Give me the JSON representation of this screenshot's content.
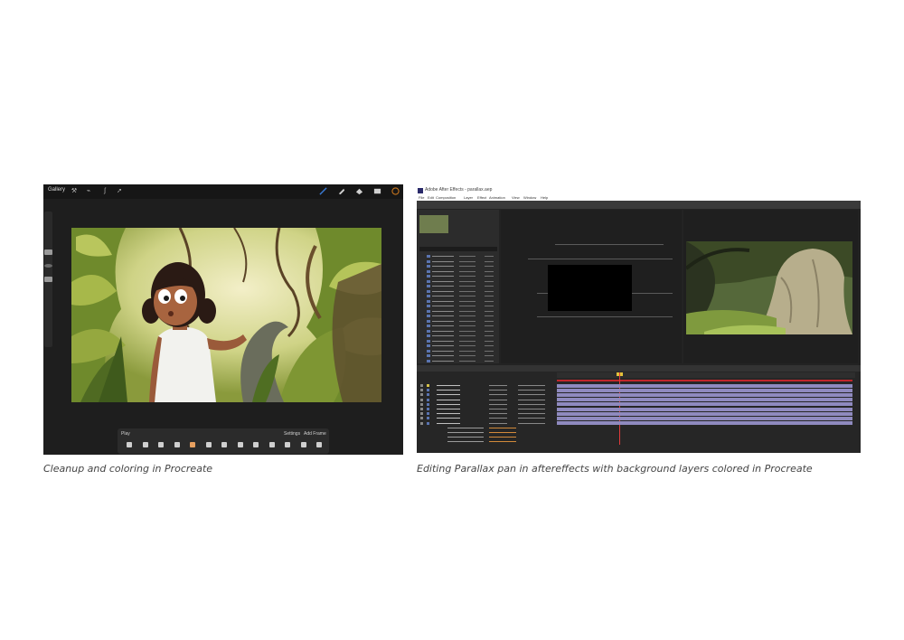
{
  "procreate": {
    "gallery_label": "Gallery",
    "playbar": {
      "play_label": "Play",
      "settings_label": "Settings",
      "add_frame_label": "Add Frame",
      "frame_count": 13,
      "active_frame": 4
    },
    "colors": {
      "brush_blue": "#3a7bd5",
      "color_swatch": "#c8761e"
    }
  },
  "aftereffects": {
    "title": "Adobe After Effects - parallax.aep",
    "menu": [
      "File",
      "Edit",
      "Composition",
      "Layer",
      "Effect",
      "Animation",
      "View",
      "Window",
      "Help"
    ],
    "colors": {
      "layer_bar": "#8f8abf",
      "playhead": "#e23b3b",
      "work_area": "#c2262a"
    }
  },
  "captions": {
    "left": "Cleanup and coloring in Procreate",
    "right": "Editing Parallax pan in aftereffects with background layers colored in Procreate"
  }
}
